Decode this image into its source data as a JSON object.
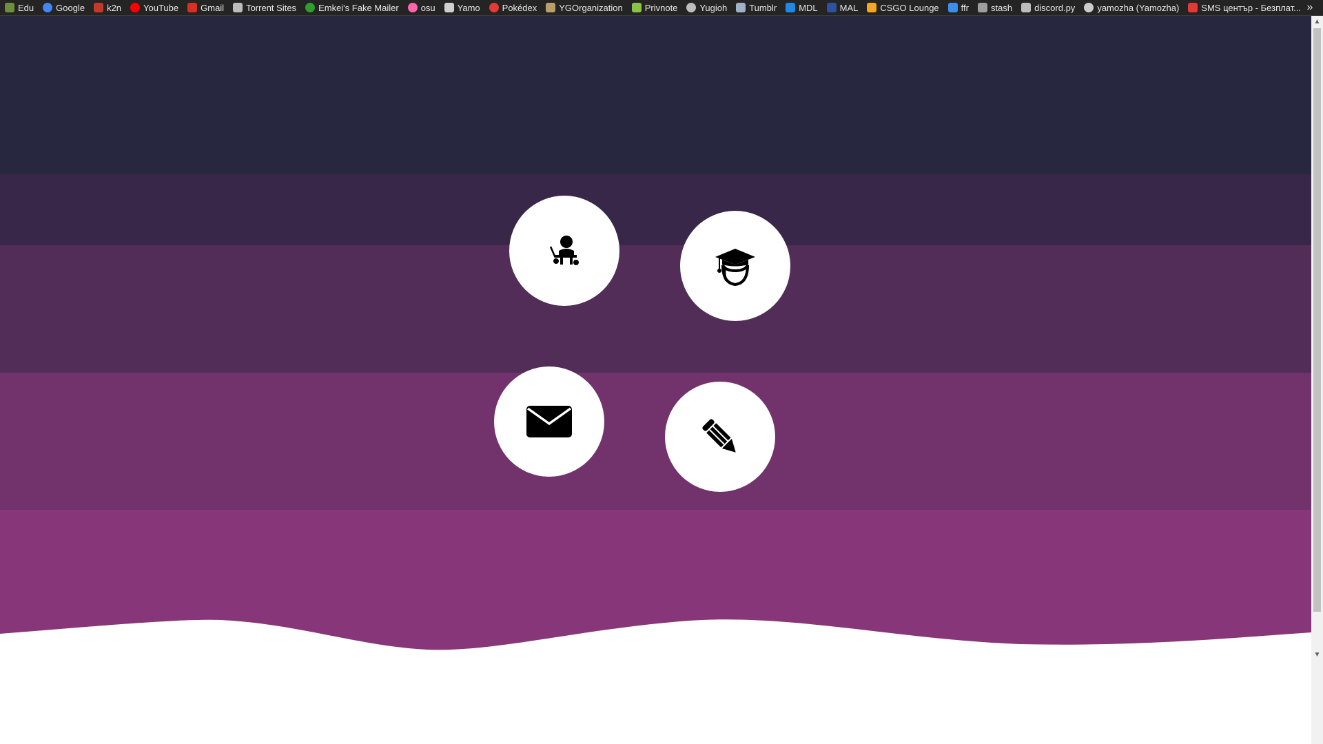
{
  "bookmarks": [
    {
      "label": "Edu",
      "icon": "leaf-icon",
      "color": "#6b8f3a"
    },
    {
      "label": "Google",
      "icon": "google-icon",
      "color": "#4285f4"
    },
    {
      "label": "k2n",
      "icon": "k2n-icon",
      "color": "#c0392b"
    },
    {
      "label": "YouTube",
      "icon": "youtube-icon",
      "color": "#ff0000"
    },
    {
      "label": "Gmail",
      "icon": "gmail-icon",
      "color": "#d93025"
    },
    {
      "label": "Torrent Sites",
      "icon": "folder-icon",
      "color": "#bdbdbd"
    },
    {
      "label": "Emkei's Fake Mailer",
      "icon": "emkei-icon",
      "color": "#2e9e2e"
    },
    {
      "label": "osu",
      "icon": "osu-icon",
      "color": "#ff66aa"
    },
    {
      "label": "Yamo",
      "icon": "steam-icon",
      "color": "#cfcfcf"
    },
    {
      "label": "Pokédex",
      "icon": "pokeball-icon",
      "color": "#e53935"
    },
    {
      "label": "YGOrganization",
      "icon": "ygo-icon",
      "color": "#b8a06a"
    },
    {
      "label": "Privnote",
      "icon": "privnote-icon",
      "color": "#8bc34a"
    },
    {
      "label": "Yugioh",
      "icon": "globe-icon",
      "color": "#bdbdbd"
    },
    {
      "label": "Tumblr",
      "icon": "tumblr-icon",
      "color": "#9fb3c8"
    },
    {
      "label": "MDL",
      "icon": "mdl-icon",
      "color": "#1e88e5"
    },
    {
      "label": "MAL",
      "icon": "mal-icon",
      "color": "#2e51a2"
    },
    {
      "label": "CSGO Lounge",
      "icon": "lightning-icon",
      "color": "#f5a623"
    },
    {
      "label": "ffr",
      "icon": "ffr-icon",
      "color": "#3d8ee8"
    },
    {
      "label": "stash",
      "icon": "stash-icon",
      "color": "#9e9e9e"
    },
    {
      "label": "discord.py",
      "icon": "document-icon",
      "color": "#bdbdbd"
    },
    {
      "label": "yamozha (Yamozha)",
      "icon": "github-icon",
      "color": "#cccccc"
    },
    {
      "label": "SMS център - Безплат...",
      "icon": "sms-icon",
      "color": "#e53935"
    }
  ],
  "overflow": {
    "glyph": "»"
  },
  "theme": {
    "band_colors": [
      "#272840",
      "#382748",
      "#512d58",
      "#72326c",
      "#873679"
    ],
    "circle_color": "#ffffff"
  },
  "nav_icons": [
    {
      "name": "teacher-icon"
    },
    {
      "name": "graduate-icon"
    },
    {
      "name": "envelope-icon"
    },
    {
      "name": "pencil-icon"
    }
  ],
  "scrollbar": {
    "up_glyph": "▲",
    "down_glyph": "▼"
  }
}
